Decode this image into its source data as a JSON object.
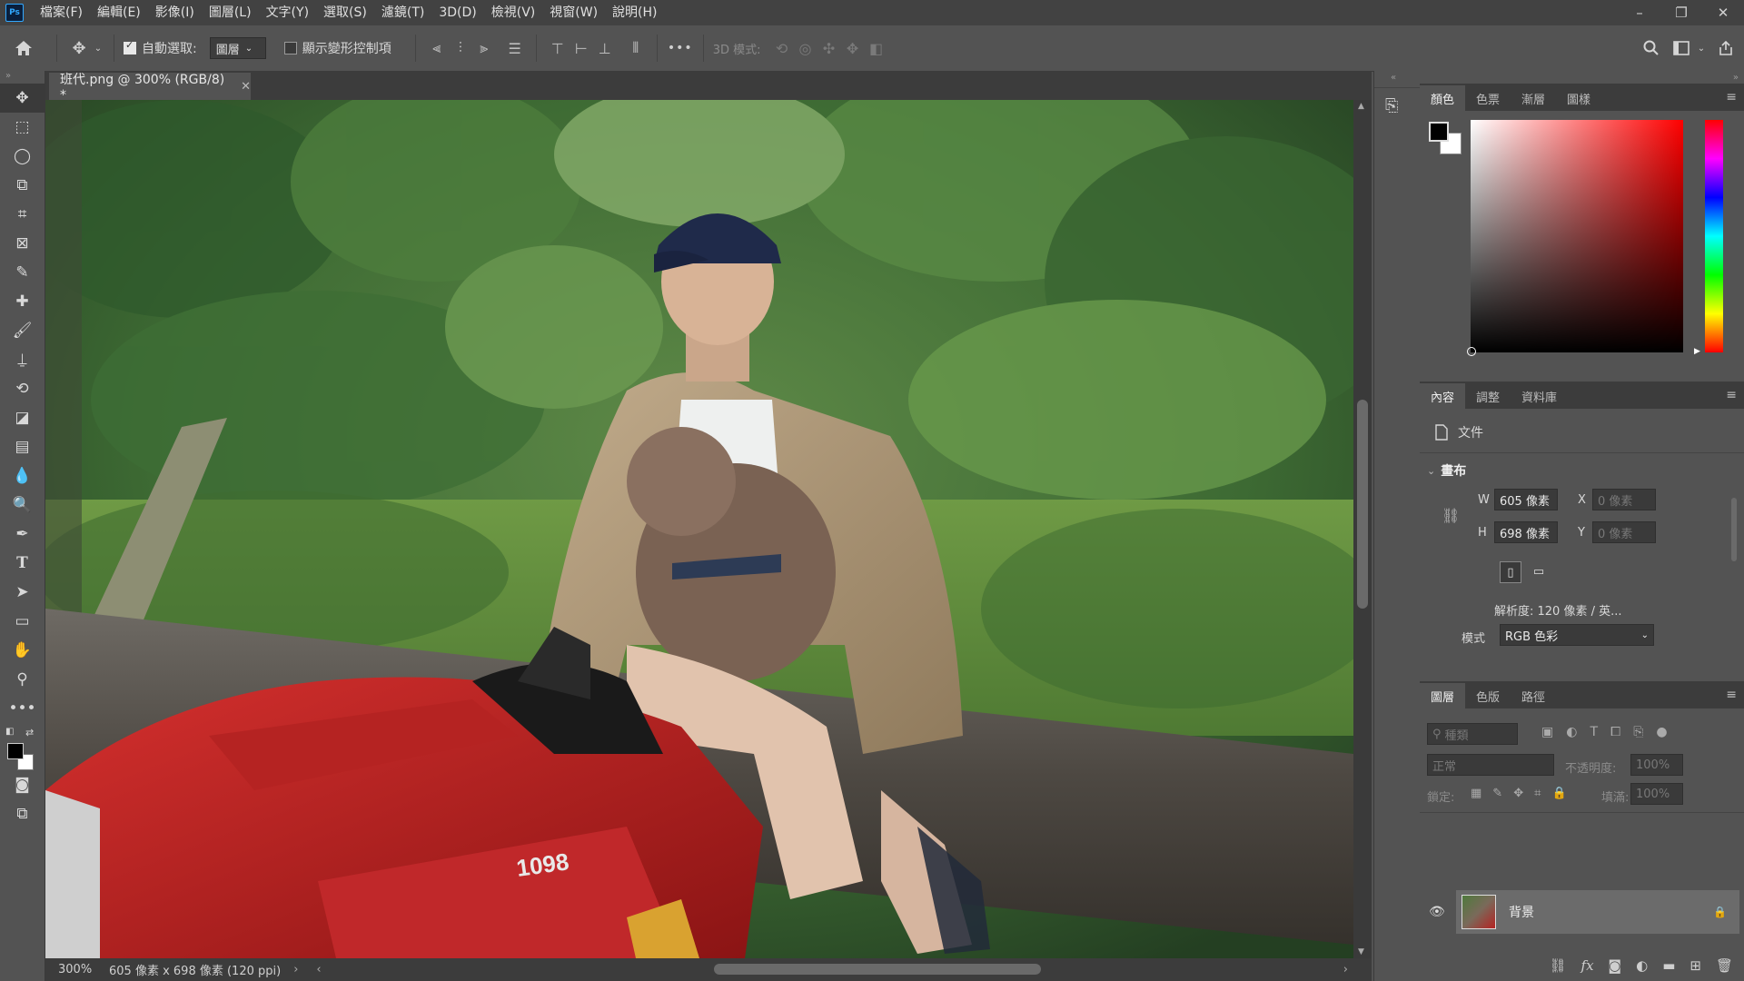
{
  "app": {
    "logo": "Ps"
  },
  "menu": [
    "檔案(F)",
    "編輯(E)",
    "影像(I)",
    "圖層(L)",
    "文字(Y)",
    "選取(S)",
    "濾鏡(T)",
    "3D(D)",
    "檢視(V)",
    "視窗(W)",
    "說明(H)"
  ],
  "window_controls": {
    "minimize": "–",
    "restore": "❐",
    "close": "✕"
  },
  "options": {
    "auto_select_label": "自動選取:",
    "auto_select_target": "圖層",
    "transform_controls_label": "顯示變形控制項",
    "more": "•••",
    "mode_3d_label": "3D 模式:"
  },
  "document": {
    "tab_title": "班代.png @ 300% (RGB/8) *",
    "zoom": "300%",
    "dimensions": "605 像素 x 698 像素 (120 ppi)"
  },
  "color_panel": {
    "tabs": [
      "顏色",
      "色票",
      "漸層",
      "圖樣"
    ],
    "active": 0
  },
  "properties_panel": {
    "tabs": [
      "內容",
      "調整",
      "資料庫"
    ],
    "active": 0,
    "doc_label": "文件",
    "section": "畫布",
    "w_label": "W",
    "w_value": "605 像素",
    "h_label": "H",
    "h_value": "698 像素",
    "x_label": "X",
    "x_placeholder": "0 像素",
    "y_label": "Y",
    "y_placeholder": "0 像素",
    "resolution": "解析度: 120 像素 / 英...",
    "mode_label": "模式",
    "mode_value": "RGB 色彩"
  },
  "layers_panel": {
    "tabs": [
      "圖層",
      "色版",
      "路徑"
    ],
    "active": 0,
    "filter_placeholder": "種類",
    "blend_mode": "正常",
    "opacity_label": "不透明度:",
    "opacity_value": "100%",
    "lock_label": "鎖定:",
    "fill_label": "填滿:",
    "fill_value": "100%",
    "layers": [
      {
        "name": "背景",
        "visible": true,
        "locked": true
      }
    ]
  },
  "colors": {
    "accent": "#31a8ff",
    "chrome": "#535353",
    "dark": "#3c3c3c"
  }
}
